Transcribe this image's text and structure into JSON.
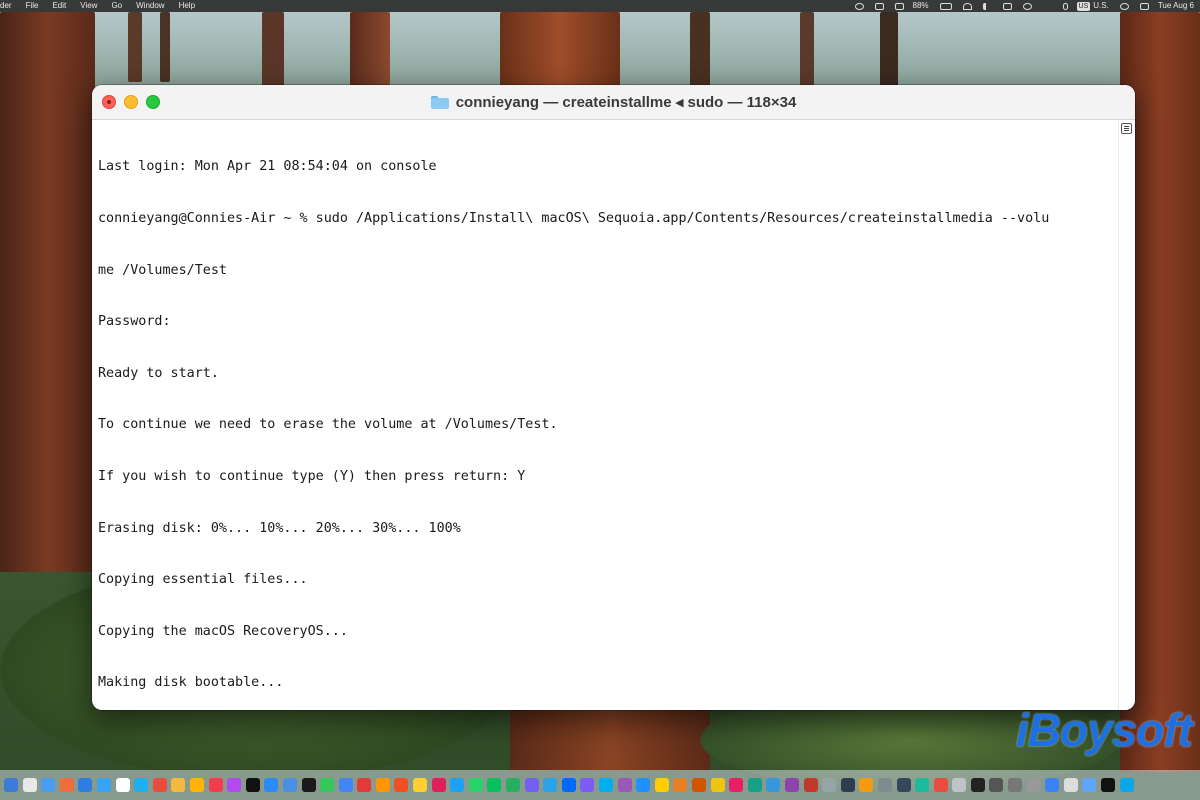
{
  "menubar": {
    "items": [
      "der",
      "File",
      "Edit",
      "View",
      "Go",
      "Window",
      "Help"
    ],
    "battery": "88%",
    "input_source": "US",
    "input_source_label": "U.S.",
    "clock": "Tue Aug 6"
  },
  "window": {
    "title": "connieyang — createinstallme ◂ sudo — 118×34",
    "lines": [
      "Last login: Mon Apr 21 08:54:04 on console",
      "connieyang@Connies-Air ~ % sudo /Applications/Install\\ macOS\\ Sequoia.app/Contents/Resources/createinstallmedia --volu",
      "me /Volumes/Test",
      "Password:",
      "Ready to start.",
      "To continue we need to erase the volume at /Volumes/Test.",
      "If you wish to continue type (Y) then press return: Y",
      "Erasing disk: 0%... 10%... 20%... 30%... 100%",
      "Copying essential files...",
      "Copying the macOS RecoveryOS...",
      "Making disk bootable..."
    ]
  },
  "watermark": "iBoysoft",
  "colors": {
    "close": "#fe5f57",
    "minimize": "#febc2e",
    "zoom": "#28c840",
    "watermark": "#1e6fe0",
    "folder": "#8dcaf2"
  },
  "dock_colors": [
    "#3d7bd8",
    "#e8e8e8",
    "#4a9cf0",
    "#f26b3a",
    "#2f7de1",
    "#36a3f2",
    "#ffffff",
    "#1eb0f0",
    "#e74c3c",
    "#f5b942",
    "#ffb400",
    "#f33d4d",
    "#b24af0",
    "#111111",
    "#2c8cf5",
    "#4a90e2",
    "#1a1a1a",
    "#34c759",
    "#4285f4",
    "#e23a3a",
    "#ff9500",
    "#f04e23",
    "#ffcf30",
    "#e01e5a",
    "#1da1f2",
    "#25d366",
    "#07c160",
    "#27ae60",
    "#7360f2",
    "#2aa4e8",
    "#0068ff",
    "#7d5cf5",
    "#00aff0",
    "#9b59b6",
    "#1e90ff",
    "#ffcc00",
    "#e67e22",
    "#d35400",
    "#f1c40f",
    "#e91e63",
    "#16a085",
    "#3498db",
    "#8e44ad",
    "#c0392b",
    "#95a5a6",
    "#2c3e50",
    "#f39c12",
    "#7f8c8d",
    "#34495e",
    "#1abc9c",
    "#e74c3c",
    "#bdc3c7",
    "#222222",
    "#555555",
    "#777777",
    "#999999",
    "#3b82f6",
    "#dddddd",
    "#60a5fa",
    "#111111",
    "#0ea5e9"
  ]
}
